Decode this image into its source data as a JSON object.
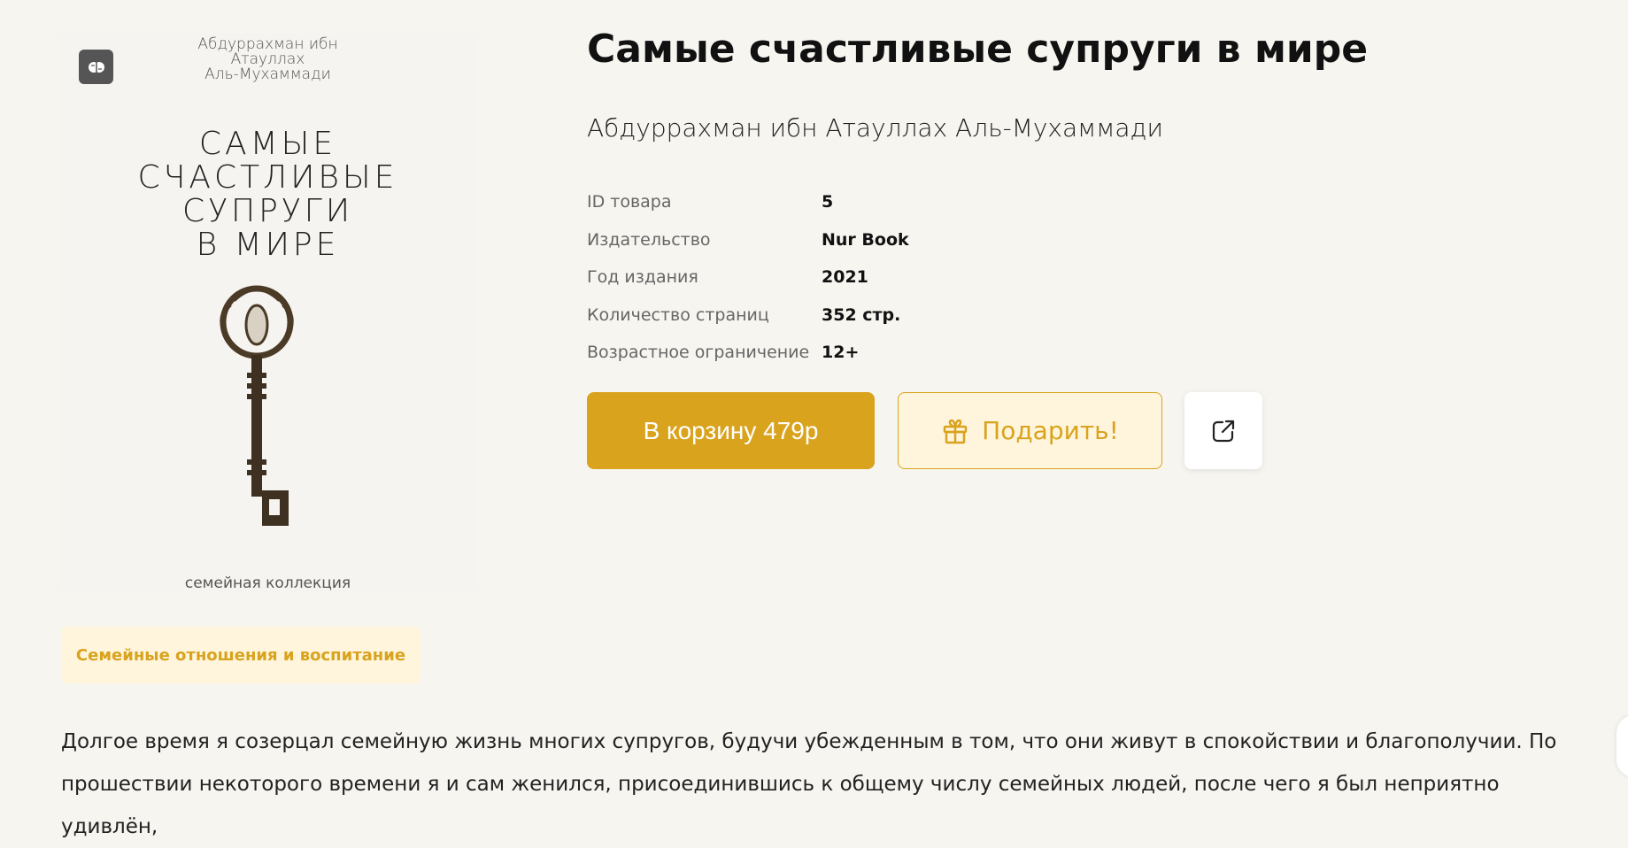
{
  "cover": {
    "author_lines": [
      "Абдуррахман ибн",
      "Атауллах",
      "Аль-Мухаммади"
    ],
    "title_lines": [
      "САМЫЕ",
      "СЧАСТЛИВЫЕ",
      "СУПРУГИ",
      "В МИРЕ"
    ],
    "collection": "семейная коллекция",
    "badge_icon": "brain-icon",
    "image_subject": "key-icon"
  },
  "product": {
    "title": "Самые счастливые супруги в мире",
    "author": "Абдуррахман ибн Атауллах Аль-Мухаммади",
    "specs": [
      {
        "label": "ID товара",
        "value": "5"
      },
      {
        "label": "Издательство",
        "value": "Nur Book"
      },
      {
        "label": "Год издания",
        "value": "2021"
      },
      {
        "label": "Количество страниц",
        "value": "352 стр."
      },
      {
        "label": "Возрастное ограничение",
        "value": "12+"
      }
    ]
  },
  "actions": {
    "cart_label": "В корзину 479р",
    "gift_label": "Подарить!",
    "gift_icon": "gift-icon",
    "share_icon": "share-icon"
  },
  "tag": "Семейные отношения и воспитание",
  "description": "Долгое время я созерцал семейную жизнь многих супругов, будучи убежденным в том, что они живут в спокойствии и благополучии. По прошествии некоторого времени я и сам женился, присоединившись к общему числу семейных людей, после чего я был неприятно удивлён,",
  "colors": {
    "accent": "#d9a31e",
    "accent_light": "#fef5dc",
    "background": "#f7f5f0"
  }
}
